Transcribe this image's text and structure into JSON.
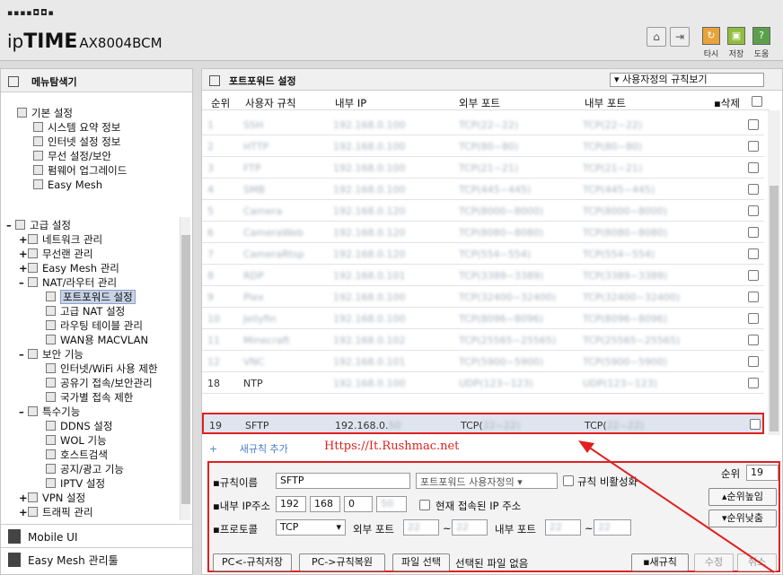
{
  "header": {
    "brand_dots": "▪▪▪▪◘◘▪",
    "logo_prefix": "ip",
    "logo_bold": "TIME",
    "logo_model": "AX8004BCM",
    "btn_labels": [
      "타시",
      "저장",
      "도움"
    ]
  },
  "sidebar": {
    "title": "메뉴탐색기",
    "basic": {
      "label": "기본 설정",
      "items": [
        "시스템 요약 정보",
        "인터넷 설정 정보",
        "무선 설정/보안",
        "펌웨어 업그레이드",
        "Easy Mesh"
      ]
    },
    "advanced": {
      "label": "고급 설정",
      "groups": [
        {
          "label": "네트워크 관리",
          "sign": "+"
        },
        {
          "label": "무선랜 관리",
          "sign": "+"
        },
        {
          "label": "Easy Mesh 관리",
          "sign": "+"
        },
        {
          "label": "NAT/라우터 관리",
          "sign": "–",
          "children": [
            "포트포워드 설정",
            "고급 NAT 설정",
            "라우팅 테이블 관리",
            "WAN용 MACVLAN"
          ]
        },
        {
          "label": "보안 기능",
          "sign": "–",
          "children": [
            "인터넷/WiFi 사용 제한",
            "공유기 접속/보안관리",
            "국가별 접속 제한"
          ]
        },
        {
          "label": "특수기능",
          "sign": "–",
          "children": [
            "DDNS 설정",
            "WOL 기능",
            "호스트검색",
            "공지/광고 기능",
            "IPTV 설정"
          ]
        },
        {
          "label": "VPN 설정",
          "sign": "+"
        },
        {
          "label": "트래픽 관리",
          "sign": "+"
        }
      ]
    },
    "bottom": [
      "Mobile UI",
      "Easy Mesh 관리툴"
    ]
  },
  "main": {
    "title": "포트포워드 설정",
    "view_select": "사용자정의 규칙보기",
    "columns": [
      "순위",
      "사용자 규칙",
      "내부 IP",
      "외부 포트",
      "내부 포트",
      "삭제"
    ],
    "rows": [
      {
        "rank": "1",
        "name": "SSH",
        "ip": "192.168.0.100",
        "ext": "TCP(22~22)",
        "int": "TCP(22~22)"
      },
      {
        "rank": "2",
        "name": "HTTP",
        "ip": "192.168.0.100",
        "ext": "TCP(80~80)",
        "int": "TCP(80~80)"
      },
      {
        "rank": "3",
        "name": "FTP",
        "ip": "192.168.0.100",
        "ext": "TCP(21~21)",
        "int": "TCP(21~21)"
      },
      {
        "rank": "4",
        "name": "SMB",
        "ip": "192.168.0.100",
        "ext": "TCP(445~445)",
        "int": "TCP(445~445)"
      },
      {
        "rank": "5",
        "name": "Camera",
        "ip": "192.168.0.120",
        "ext": "TCP(8000~8000)",
        "int": "TCP(8000~8000)"
      },
      {
        "rank": "6",
        "name": "CameraWeb",
        "ip": "192.168.0.120",
        "ext": "TCP(8080~8080)",
        "int": "TCP(8080~8080)"
      },
      {
        "rank": "7",
        "name": "CameraRtsp",
        "ip": "192.168.0.120",
        "ext": "TCP(554~554)",
        "int": "TCP(554~554)"
      },
      {
        "rank": "8",
        "name": "RDP",
        "ip": "192.168.0.101",
        "ext": "TCP(3389~3389)",
        "int": "TCP(3389~3389)"
      },
      {
        "rank": "9",
        "name": "Plex",
        "ip": "192.168.0.100",
        "ext": "TCP(32400~32400)",
        "int": "TCP(32400~32400)"
      },
      {
        "rank": "10",
        "name": "Jellyfin",
        "ip": "192.168.0.100",
        "ext": "TCP(8096~8096)",
        "int": "TCP(8096~8096)"
      },
      {
        "rank": "11",
        "name": "Minecraft",
        "ip": "192.168.0.102",
        "ext": "TCP(25565~25565)",
        "int": "TCP(25565~25565)"
      },
      {
        "rank": "12",
        "name": "VNC",
        "ip": "192.168.0.101",
        "ext": "TCP(5900~5900)",
        "int": "TCP(5900~5900)"
      },
      {
        "rank": "18",
        "name": "NTP",
        "ip": "192.168.0.100",
        "ext": "UDP(123~123)",
        "int": "UDP(123~123)"
      }
    ],
    "highlight_row": {
      "rank": "19",
      "name": "SFTP",
      "ip_visible": "192.168.0.",
      "ip_blur": "50",
      "ext_visible": "TCP(",
      "ext_blur": "22~22)",
      "int_visible": "TCP(",
      "int_blur": "22~22)"
    },
    "new_rule": "새규칙 추가",
    "annotation": "Https://It.Rushmac.net",
    "form": {
      "rule_name_label": "규칙이름",
      "rule_name": "SFTP",
      "preset": "포트포워드 사용자정의",
      "disable_label": "규칙 비활성화",
      "rank_label": "순위",
      "rank": "19",
      "ip_label": "내부 IP주소",
      "ip": [
        "192",
        "168",
        "0",
        "50"
      ],
      "current_ip_label": "현재 접속된 IP 주소",
      "proto_label": "프로토콜",
      "proto": "TCP",
      "ext_label": "외부 포트",
      "int_label": "내부 포트",
      "ext_from": "22",
      "ext_to": "22",
      "int_from": "22",
      "int_to": "22",
      "tilde": "~",
      "up": "순위높임",
      "down": "순위낮춤",
      "save_btn": "PC<-규칙저장",
      "restore_btn": "PC->규칙복원",
      "file_btn": "파일 선택",
      "file_status": "선택된 파일 없음",
      "new_btn": "새규칙",
      "edit_btn": "수정",
      "cancel_btn": "취소"
    },
    "colors": {
      "highlight": "#e02020",
      "selected": "#c9d3e6"
    }
  }
}
